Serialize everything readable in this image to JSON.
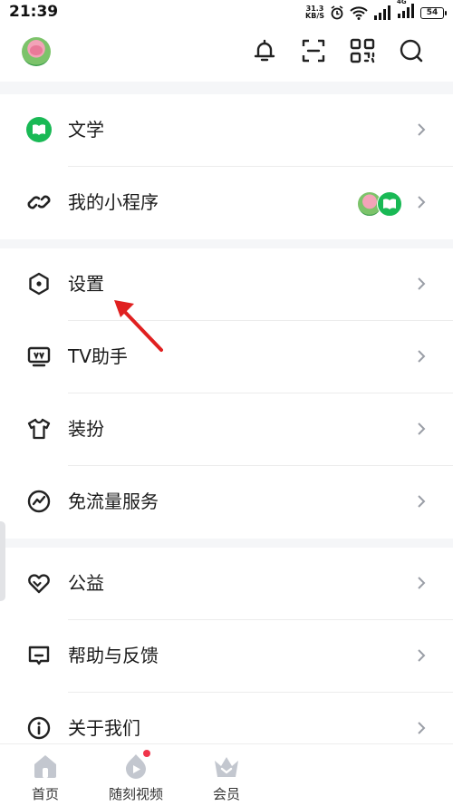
{
  "status_bar": {
    "time": "21:39",
    "net_speed_value": "31.3",
    "net_speed_unit": "KB/S",
    "network_type": "4G",
    "battery": "54"
  },
  "header": {
    "icons": [
      "bell-icon",
      "scan-icon",
      "qr-code-icon",
      "search-icon"
    ]
  },
  "sections": [
    {
      "items": [
        {
          "label": "文学",
          "icon": "literature-icon"
        },
        {
          "label": "我的小程序",
          "icon": "mini-program-icon"
        }
      ]
    },
    {
      "items": [
        {
          "label": "设置",
          "icon": "settings-icon"
        },
        {
          "label": "TV助手",
          "icon": "tv-icon"
        },
        {
          "label": "装扮",
          "icon": "tshirt-icon"
        },
        {
          "label": "免流量服务",
          "icon": "data-free-icon"
        }
      ]
    },
    {
      "items": [
        {
          "label": "公益",
          "icon": "charity-heart-icon"
        },
        {
          "label": "帮助与反馈",
          "icon": "feedback-icon"
        },
        {
          "label": "关于我们",
          "icon": "info-icon"
        }
      ]
    }
  ],
  "bottom_nav": {
    "items": [
      {
        "label": "首页",
        "icon": "home-icon"
      },
      {
        "label": "随刻视频",
        "icon": "video-icon",
        "badge": true
      },
      {
        "label": "会员",
        "icon": "vip-crown-icon"
      }
    ]
  },
  "colors": {
    "brand_green": "#19b955",
    "badge_red": "#f0354b",
    "arrow_red": "#e02020",
    "bottom_icon": "#c3c7cf"
  }
}
